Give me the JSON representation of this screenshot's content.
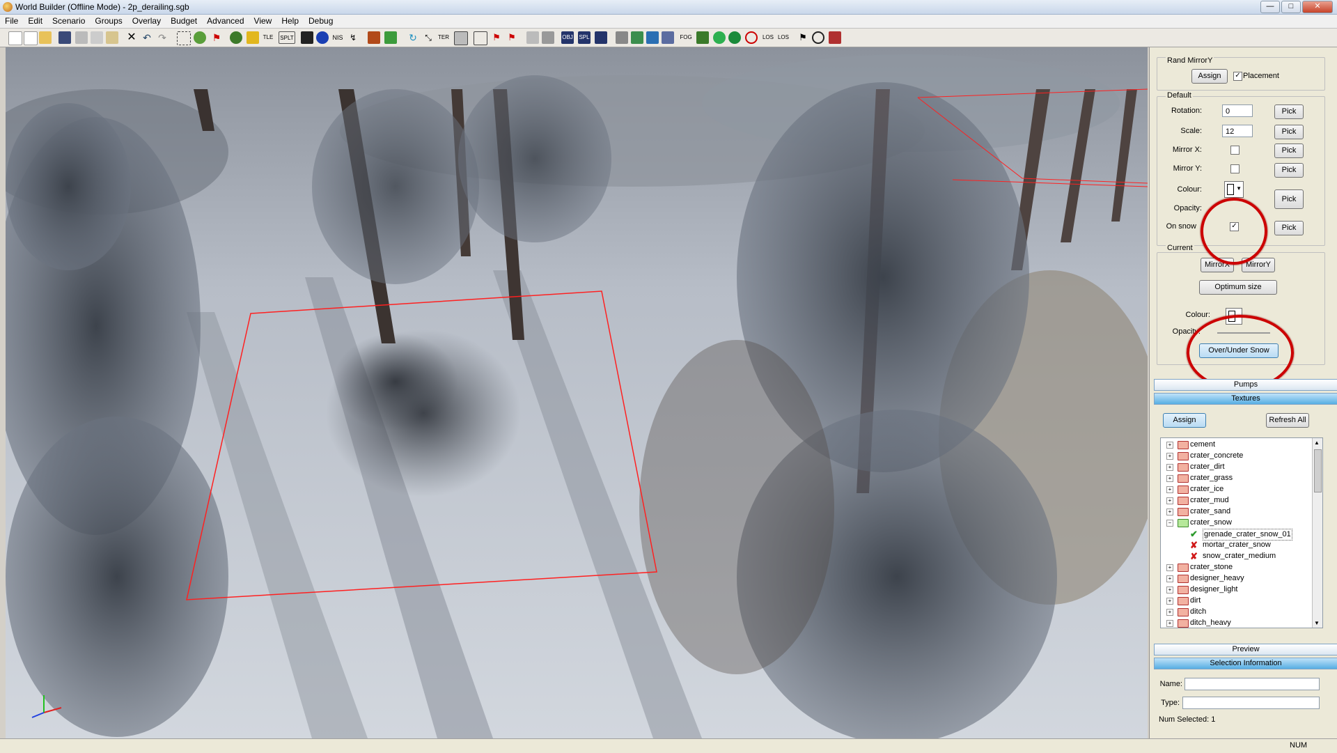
{
  "window": {
    "title": "World Builder (Offline Mode) - 2p_derailing.sgb",
    "minimize": "—",
    "maximize": "□",
    "close": "✕"
  },
  "menu": [
    "File",
    "Edit",
    "Scenario",
    "Groups",
    "Overlay",
    "Budget",
    "Advanced",
    "View",
    "Help",
    "Debug"
  ],
  "toolbar": {
    "tle": "TLE",
    "splt": "SPLT",
    "nis": "NIS",
    "ter": "TER",
    "obj": "OBJ",
    "spl": "SPL",
    "fog": "FOG",
    "los1": "LOS",
    "los2": "LOS"
  },
  "panel": {
    "rand_mirror": {
      "label": "Rand MirrorY",
      "assign": "Assign",
      "placement_label": "Placement",
      "placement_checked": "✓"
    },
    "default": {
      "label": "Default",
      "rotation_label": "Rotation:",
      "rotation_value": "0",
      "scale_label": "Scale:",
      "scale_value": "12",
      "mirror_x_label": "Mirror X:",
      "mirror_y_label": "Mirror Y:",
      "colour_label": "Colour:",
      "opacity_label": "Opacity:",
      "on_snow_label": "On snow",
      "on_snow_checked": "✓",
      "pick": "Pick"
    },
    "current": {
      "label": "Current",
      "mirror_x": "MirrorX",
      "mirror_y": "MirrorY",
      "optimum_size": "Optimum size",
      "colour_label": "Colour:",
      "opacity_label": "Opacity:",
      "over_under_snow": "Over/Under Snow"
    },
    "sections": {
      "pumps": "Pumps",
      "textures": "Textures",
      "preview": "Preview",
      "selection_info": "Selection Information"
    },
    "textures": {
      "assign": "Assign",
      "refresh_all": "Refresh All"
    },
    "tree": [
      {
        "label": "cement",
        "type": "folder"
      },
      {
        "label": "crater_concrete",
        "type": "folder"
      },
      {
        "label": "crater_dirt",
        "type": "folder"
      },
      {
        "label": "crater_grass",
        "type": "folder"
      },
      {
        "label": "crater_ice",
        "type": "folder"
      },
      {
        "label": "crater_mud",
        "type": "folder"
      },
      {
        "label": "crater_sand",
        "type": "folder"
      },
      {
        "label": "crater_snow",
        "type": "open-folder"
      },
      {
        "label": "grenade_crater_snow_01",
        "type": "ok-item"
      },
      {
        "label": "mortar_crater_snow",
        "type": "bad-item"
      },
      {
        "label": "snow_crater_medium",
        "type": "bad-item"
      },
      {
        "label": "crater_stone",
        "type": "folder"
      },
      {
        "label": "designer_heavy",
        "type": "folder"
      },
      {
        "label": "designer_light",
        "type": "folder"
      },
      {
        "label": "dirt",
        "type": "folder"
      },
      {
        "label": "ditch",
        "type": "folder"
      },
      {
        "label": "ditch_heavy",
        "type": "folder"
      }
    ],
    "selection": {
      "name_label": "Name:",
      "type_label": "Type:",
      "num_selected": "Num Selected: 1"
    }
  },
  "status": {
    "num": "NUM"
  }
}
